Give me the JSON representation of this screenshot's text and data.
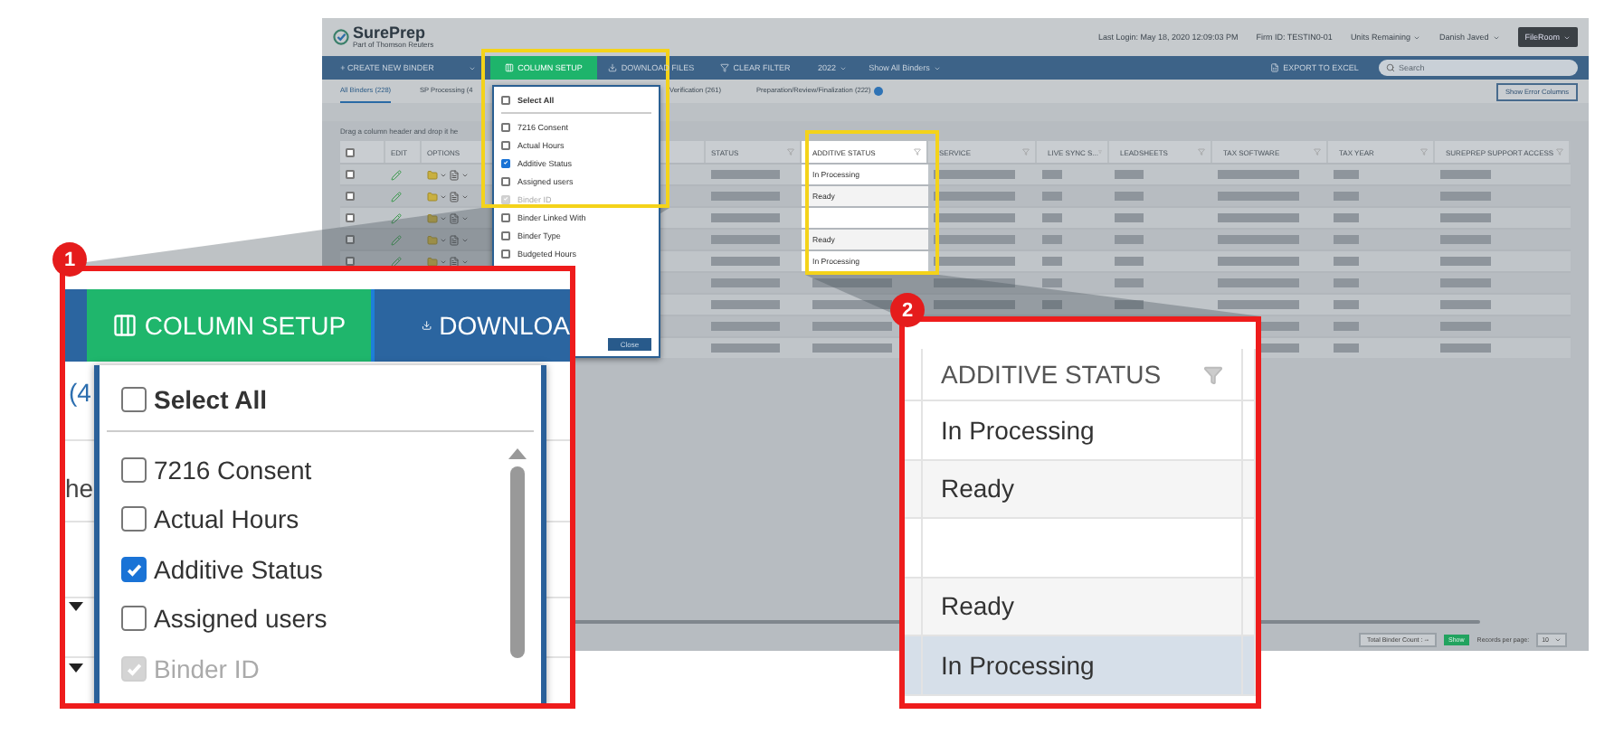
{
  "header": {
    "brand": "SurePrep",
    "tagline": "Part of Thomson Reuters",
    "last_login": "Last Login: May 18, 2020 12:09:03 PM",
    "firm_id": "Firm ID:  TESTIN0-01",
    "units": "Units Remaining",
    "user": "Danish Javed",
    "app_menu": "FileRoom"
  },
  "toolbar": {
    "create": "+ CREATE NEW BINDER",
    "column_setup": "COLUMN SETUP",
    "download": "DOWNLOAD FILES",
    "clear_filter": "CLEAR FILTER",
    "year": "2022",
    "binder_filter": "Show All Binders",
    "export": "EXPORT TO EXCEL",
    "search_placeholder": "Search"
  },
  "tabs": [
    {
      "label": "All Binders (228)",
      "selected": true
    },
    {
      "label": "SP Processing (4",
      "selected": false
    },
    {
      "label": "Verification (261)",
      "selected": false
    },
    {
      "label": "Preparation/Review/Finalization (222)",
      "selected": false
    }
  ],
  "show_error_columns": "Show Error Columns",
  "group_hint": "Drag a column header and drop it he",
  "table_checkbox": {
    "checked": false
  },
  "columns": [
    {
      "kind": "text",
      "label": "EDIT"
    },
    {
      "kind": "text",
      "label": "OPTIONS"
    },
    {
      "kind": "hidden"
    },
    {
      "kind": "hidden"
    },
    {
      "kind": "text",
      "label": "STATUS"
    },
    {
      "kind": "text",
      "label": "ADDITIVE STATUS"
    },
    {
      "kind": "text",
      "label": "SERVICE"
    },
    {
      "kind": "text",
      "label": "LIVE SYNC S..."
    },
    {
      "kind": "text",
      "label": "LEADSHEETS"
    },
    {
      "kind": "text",
      "label": "TAX SOFTWARE"
    },
    {
      "kind": "text",
      "label": "TAX YEAR"
    },
    {
      "kind": "text",
      "label": "SUREPREP SUPPORT ACCESS"
    }
  ],
  "rows": [
    {
      "kind": "text",
      "additive_status": "In Processing",
      "checked": false
    },
    {
      "kind": "text",
      "additive_status": "Ready",
      "checked": false
    },
    {
      "kind": "blank",
      "checked": false
    },
    {
      "kind": "text",
      "additive_status": "Ready",
      "checked": false
    },
    {
      "kind": "text",
      "additive_status": "In Processing",
      "checked": false
    },
    {
      "kind": "redacted"
    },
    {
      "kind": "redacted"
    },
    {
      "kind": "redacted"
    },
    {
      "kind": "redacted"
    }
  ],
  "column_menu": {
    "select_all": {
      "label": "Select All",
      "checked": false
    },
    "items": [
      {
        "label": "7216 Consent",
        "checked": false,
        "disabled": false
      },
      {
        "label": "Actual Hours",
        "checked": false,
        "disabled": false
      },
      {
        "label": "Additive Status",
        "checked": true,
        "disabled": false
      },
      {
        "label": "Assigned users",
        "checked": false,
        "disabled": false
      },
      {
        "label": "Binder ID",
        "checked": true,
        "disabled": true
      },
      {
        "label": "Binder Linked With",
        "checked": false,
        "disabled": false
      },
      {
        "label": "Binder Type",
        "checked": false,
        "disabled": false
      },
      {
        "label": "Budgeted Hours",
        "checked": false,
        "disabled": false
      }
    ],
    "close": "Close"
  },
  "footer": {
    "total": "Total Binder Count : --",
    "show": "Show",
    "records_label": "Records per page:",
    "records_value": "10"
  },
  "callout_1": {
    "badge": "1",
    "column_setup": "COLUMN SETUP",
    "download": "DOWNLOA",
    "fragments": [
      "(4",
      "he"
    ],
    "select_all": {
      "label": "Select All",
      "checked": false
    },
    "items": [
      {
        "label": "7216 Consent",
        "checked": false,
        "disabled": false
      },
      {
        "label": "Actual Hours",
        "checked": false,
        "disabled": false
      },
      {
        "label": "Additive Status",
        "checked": true,
        "disabled": false
      },
      {
        "label": "Assigned users",
        "checked": false,
        "disabled": false
      },
      {
        "label": "Binder ID",
        "checked": true,
        "disabled": true
      }
    ]
  },
  "callout_2": {
    "badge": "2",
    "header": "ADDITIVE STATUS",
    "cells": [
      {
        "kind": "text",
        "text": "In Processing",
        "highlighted": false
      },
      {
        "kind": "text",
        "text": "Ready",
        "highlighted": false
      },
      {
        "kind": "blank",
        "highlighted": false
      },
      {
        "kind": "text",
        "text": "Ready",
        "highlighted": false
      },
      {
        "kind": "text",
        "text": "In Processing",
        "highlighted": true
      }
    ]
  }
}
